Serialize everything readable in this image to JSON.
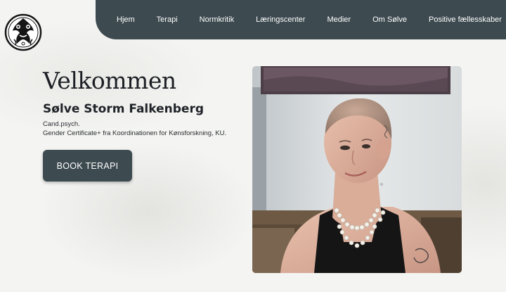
{
  "nav": {
    "items": [
      {
        "label": "Hjem"
      },
      {
        "label": "Terapi"
      },
      {
        "label": "Normkritik"
      },
      {
        "label": "Læringscenter"
      },
      {
        "label": "Medier"
      },
      {
        "label": "Om Sølve"
      },
      {
        "label": "Positive fællesskaber"
      }
    ]
  },
  "hero": {
    "headline": "Velkommen",
    "name": "Sølve Storm Falkenberg",
    "credentials": [
      "Cand.psych.",
      "Gender Certificate+ fra Koordinationen for Kønsforskning, KU."
    ],
    "cta_label": "BOOK TERAPI"
  },
  "colors": {
    "nav_bg": "#3d4a50",
    "button_bg": "#3d4a50",
    "page_bg": "#f4f4f2",
    "text_dark": "#1c1f24"
  },
  "icons": {
    "logo": "ornamental-circle-logo-icon",
    "photo": "portrait-photo"
  }
}
